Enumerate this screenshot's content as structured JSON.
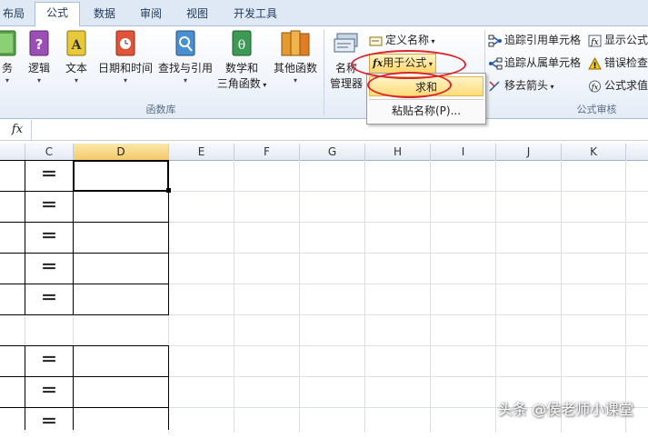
{
  "tabs": [
    {
      "label": "布局",
      "active": false
    },
    {
      "label": "公式",
      "active": true
    },
    {
      "label": "数据",
      "active": false
    },
    {
      "label": "审阅",
      "active": false
    },
    {
      "label": "视图",
      "active": false
    },
    {
      "label": "开发工具",
      "active": false
    }
  ],
  "ribbon": {
    "function_library": {
      "buttons": [
        "务",
        "逻辑",
        "文本",
        "日期和时间",
        "查找与引用",
        "数学和",
        "三角函数",
        "其他函数"
      ],
      "group_label": "函数库"
    },
    "defined_names": {
      "name_manager_line1": "名称",
      "name_manager_line2": "管理器",
      "define_name": "定义名称",
      "use_in_formula": "用于公式"
    },
    "formula_auditing": {
      "trace_precedents": "追踪引用单元格",
      "trace_dependents": "追踪从属单元格",
      "remove_arrows": "移去箭头",
      "show_formulas": "显示公式",
      "error_checking": "错误检查",
      "evaluate_formula": "公式求值",
      "group_label": "公式审核"
    }
  },
  "dropdown": {
    "items": [
      "求和",
      "粘贴名称(P)..."
    ],
    "highlighted_index": 0
  },
  "formula_bar": {
    "fx": "fx",
    "value": ""
  },
  "grid": {
    "columns": [
      "C",
      "D",
      "E",
      "F",
      "G",
      "H",
      "I",
      "J",
      "K"
    ],
    "selected_column": "D",
    "cell_symbol": "＝"
  },
  "watermark": "头条 @侯老师小课堂",
  "colors": {
    "accent_red": "#d8262c",
    "highlight": "#ffdc7a"
  }
}
